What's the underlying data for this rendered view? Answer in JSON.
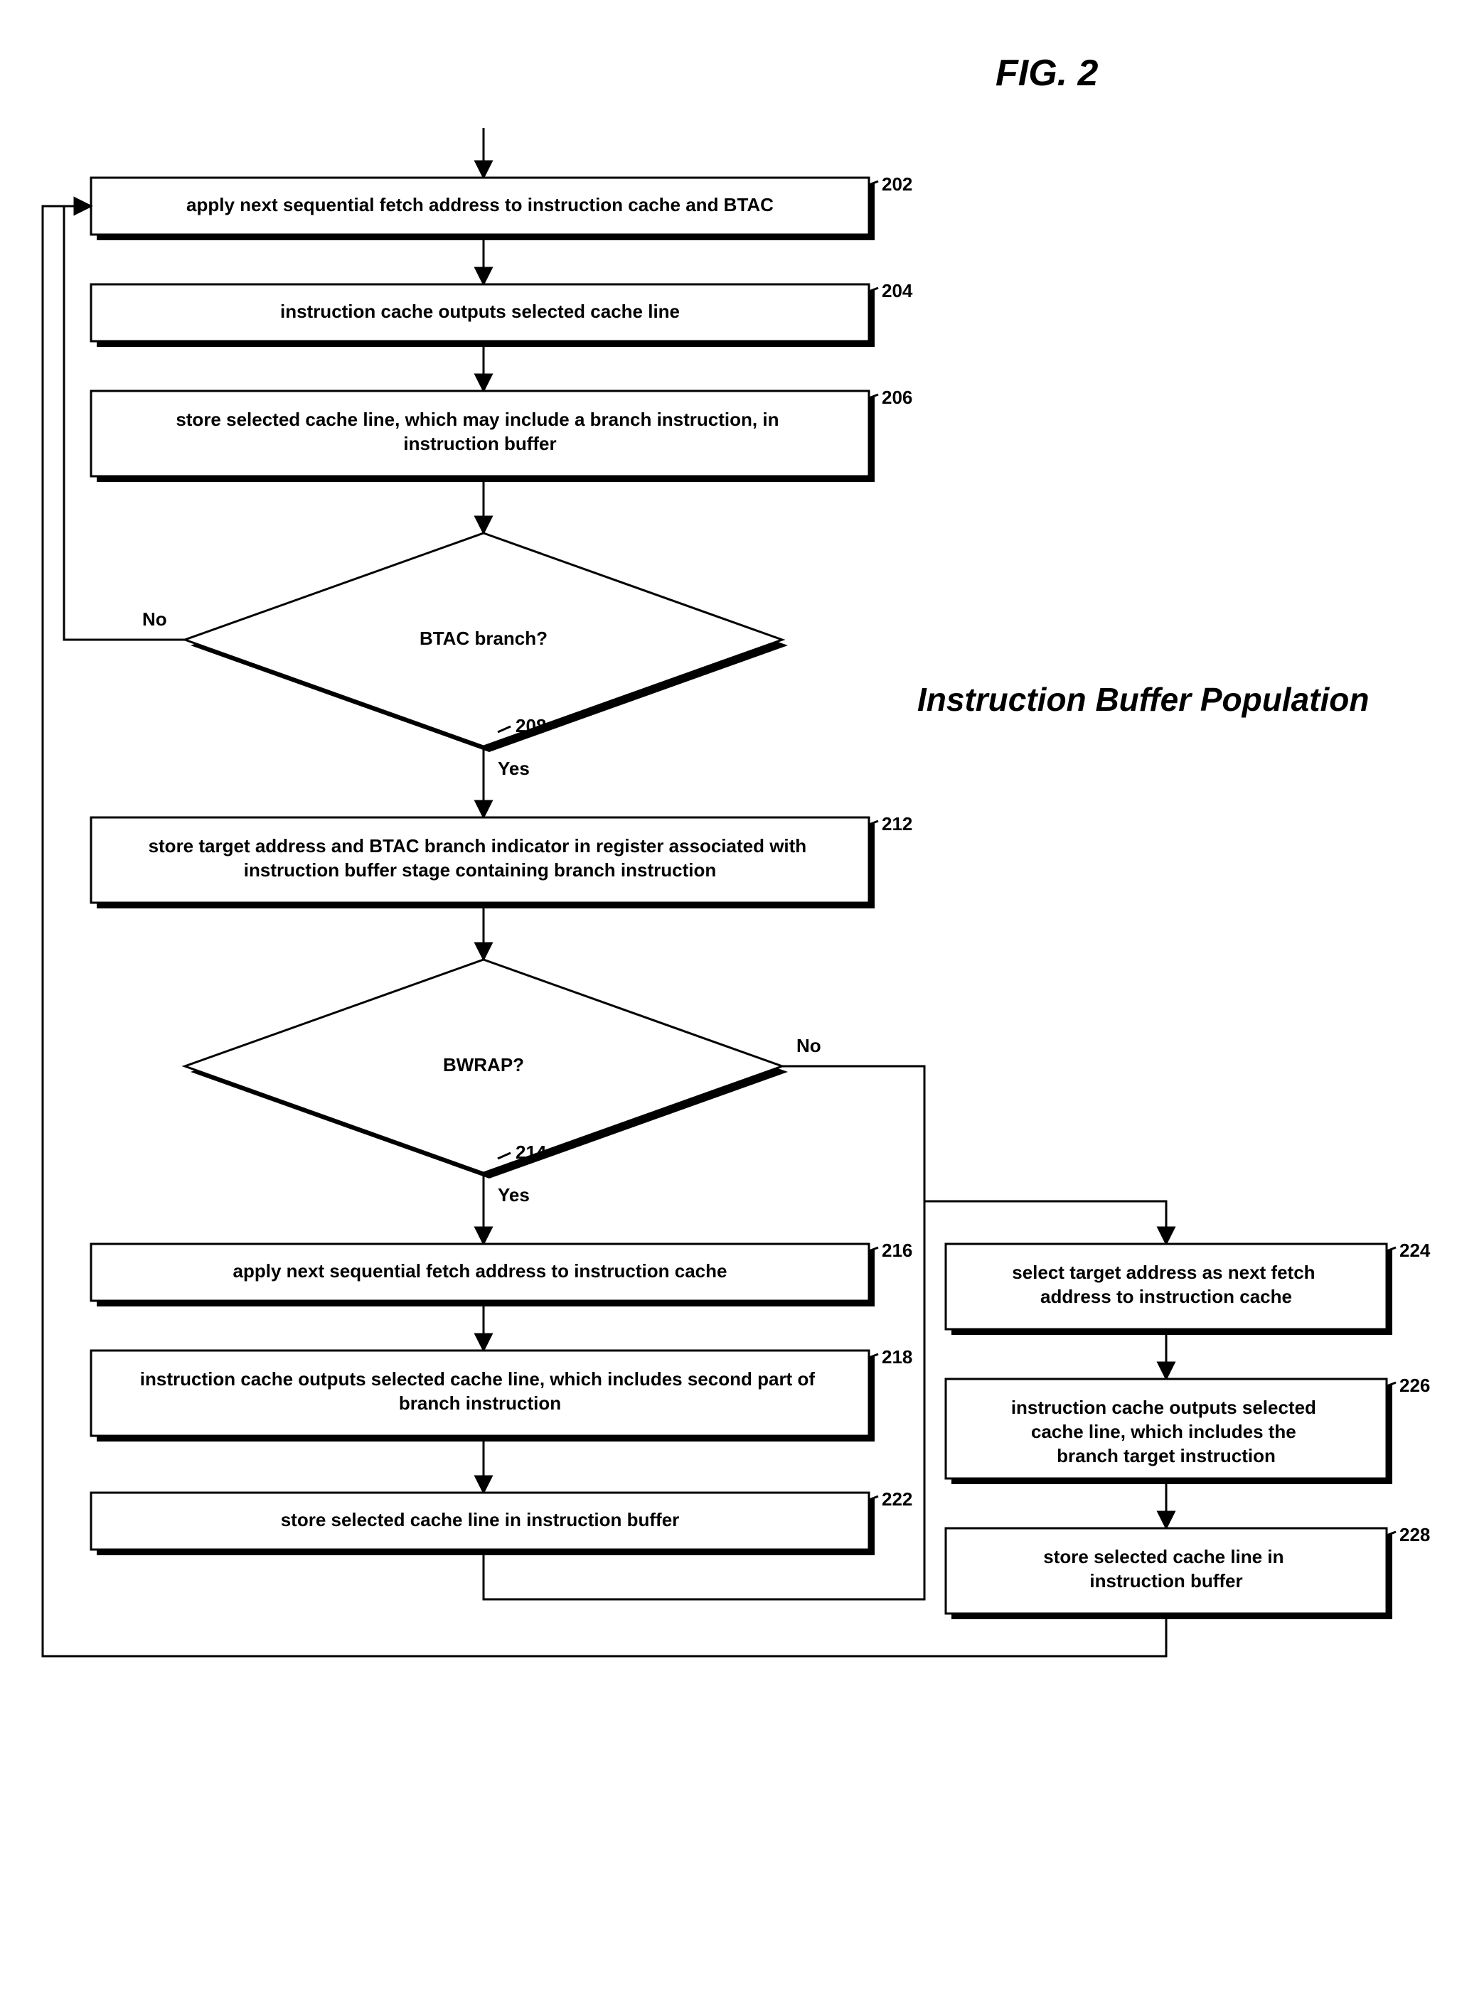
{
  "figure_label": "FIG. 2",
  "title": "Instruction Buffer Population",
  "nodes": {
    "b202": {
      "text": "apply next sequential fetch address to instruction cache and BTAC",
      "ref": "202"
    },
    "b204": {
      "text": "instruction cache outputs selected cache line",
      "ref": "204"
    },
    "b206": {
      "text": "store selected cache line, which may include a branch instruction, in instruction buffer",
      "ref": "206"
    },
    "d208": {
      "text": "BTAC branch?",
      "ref": "208",
      "yes": "Yes",
      "no": "No"
    },
    "b212": {
      "text": "store target address and BTAC branch indicator in register associated with instruction buffer stage containing branch instruction",
      "ref": "212"
    },
    "d214": {
      "text": "BWRAP?",
      "ref": "214",
      "yes": "Yes",
      "no": "No"
    },
    "b216": {
      "text": "apply next sequential fetch address to instruction cache",
      "ref": "216"
    },
    "b218": {
      "text": "instruction cache outputs selected cache line, which includes second part of branch instruction",
      "ref": "218"
    },
    "b222": {
      "text": "store selected cache line in instruction buffer",
      "ref": "222"
    },
    "b224": {
      "text": "select target address as next fetch address to instruction cache",
      "ref": "224"
    },
    "b226": {
      "text": "instruction cache outputs selected cache line, which includes the branch target instruction",
      "ref": "226"
    },
    "b228": {
      "text": "store selected cache line in instruction buffer",
      "ref": "228"
    }
  }
}
